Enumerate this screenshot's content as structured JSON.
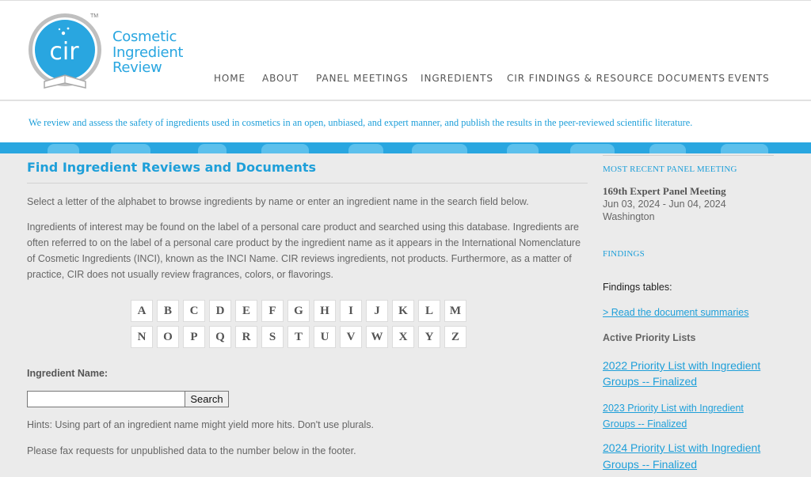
{
  "brand": {
    "logo_text": "cir",
    "tm": "TM",
    "name_line1": "Cosmetic",
    "name_line2": "Ingredient",
    "name_line3": "Review"
  },
  "nav": [
    {
      "label": "HOME"
    },
    {
      "label": "ABOUT"
    },
    {
      "label": "PANEL MEETINGS"
    },
    {
      "label": "INGREDIENTS"
    },
    {
      "label": "CIR FINDINGS & RESOURCE DOCUMENTS"
    },
    {
      "label": "EVENTS"
    }
  ],
  "mission": "We review and assess the safety of ingredients used in cosmetics in an open, unbiased, and expert manner, and publish the results in the peer-reviewed scientific literature.",
  "main": {
    "title": "Find Ingredient Reviews and Documents",
    "intro": "Select a letter of the alphabet to browse ingredients by name or enter an ingredient name in the search field below.",
    "body": "Ingredients of interest may be found on the label of a personal care product and searched using this database. Ingredients are often referred to on the label of a personal care product by the ingredient name as it appears in the International Nomenclature of Cosmetic Ingredients (INCI), known as the INCI Name. CIR reviews ingredients, not products. Furthermore, as a matter of practice, CIR does not usually review fragrances, colors, or flavorings.",
    "letters_row1": [
      "A",
      "B",
      "C",
      "D",
      "E",
      "F",
      "G",
      "H",
      "I",
      "J",
      "K",
      "L",
      "M"
    ],
    "letters_row2": [
      "N",
      "O",
      "P",
      "Q",
      "R",
      "S",
      "T",
      "U",
      "V",
      "W",
      "X",
      "Y",
      "Z"
    ],
    "ingredient_label": "Ingredient Name:",
    "search_value": "",
    "search_button": "Search",
    "hint1": "Hints: Using part of an ingredient name might yield more hits. Don't use plurals.",
    "hint2": "Please fax requests for unpublished data to the number below in the footer."
  },
  "sidebar": {
    "recent_head": "MOST RECENT PANEL MEETING",
    "meeting_title": "169th Expert Panel Meeting",
    "meeting_dates": "Jun 03, 2024 - Jun 04, 2024",
    "meeting_location": "Washington",
    "findings_head": "FINDINGS",
    "findings_tables": "Findings tables:",
    "read_summaries": "> Read the document summaries",
    "active_lists": "Active Priority Lists",
    "list_2022_a": "2022 Priority List with Ingredient",
    "list_2022_b": "Groups -- Finalized",
    "list_2023_a": "2023 Priority List with Ingredient",
    "list_2023_b": "Groups -- Finalized",
    "list_2024_a": "2024 Priority List with Ingredient",
    "list_2024_b": "Groups -- Finalized"
  },
  "colors": {
    "accent": "#29a6e0",
    "background": "#ebebeb"
  }
}
